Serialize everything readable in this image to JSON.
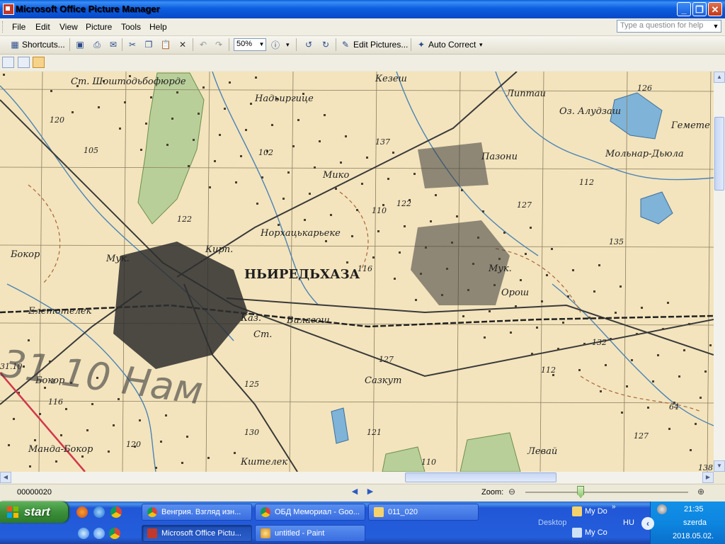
{
  "window": {
    "title": "Microsoft Office Picture Manager"
  },
  "caption_buttons": {
    "minimize": "_",
    "restore": "❐",
    "close": "✕"
  },
  "menu": [
    "File",
    "Edit",
    "View",
    "Picture",
    "Tools",
    "Help"
  ],
  "help_box": {
    "placeholder": "Type a question for help"
  },
  "toolbar": {
    "shortcuts": "Shortcuts...",
    "zoom_value": "50%",
    "edit_pictures": "Edit Pictures...",
    "auto_correct": "Auto Correct"
  },
  "map": {
    "labels": [
      "Ст. Шоштодьбофюрде",
      "Кезеш",
      "Надьиргице",
      "Липтаи",
      "126",
      "Оз. Алудзаш",
      "Гемете",
      "Мольнар-Дьюла",
      "120",
      "105",
      "102",
      "137",
      "Пазони",
      "Мико",
      "112",
      "110",
      "122",
      "127",
      "135",
      "122",
      "Норхацькарьеке",
      "Бокор",
      "Кирп.",
      "Мук.",
      "НЬИРЕДЬХАЗА",
      "116",
      "Мук.",
      "Орош",
      "Елетотелек",
      "Каз.",
      "Вилагош",
      "Ст.",
      "132",
      "31.10",
      "Бокор",
      "127",
      "Сазкут",
      "116",
      "125",
      "112",
      "Манда-Бокор",
      "130",
      "120",
      "121",
      "127",
      "64",
      "Кштелек",
      "Левай",
      "110",
      "138"
    ],
    "overlay_text": "31.10 Нам"
  },
  "status": {
    "file_name": "00000020",
    "zoom_label": "Zoom:",
    "zoom_level": 0.34
  },
  "taskbar": {
    "start": "start",
    "tasks_row1": [
      "Венгрия. Взгляд изн...",
      "ОБД Мемориал - Goo...",
      "011_020"
    ],
    "tasks_row2": [
      "Microsoft Office Pictu...",
      "untitled - Paint"
    ],
    "desktop": "Desktop",
    "toolbar_items": [
      "My Do",
      "My Co"
    ],
    "language": "HU",
    "clock": {
      "time": "21:35",
      "day": "szerda",
      "date": "2018.05.02."
    }
  }
}
